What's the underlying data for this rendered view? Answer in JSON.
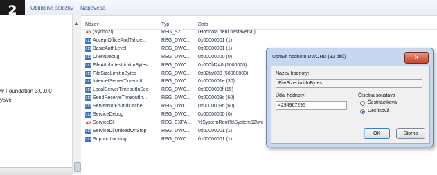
{
  "step_number": "2",
  "menu": {
    "favorites": "Oblíbené položky",
    "help": "Nápověda"
  },
  "left_pane": {
    "item1": "w Foundation 3.0.0.0",
    "item2": "y5vc"
  },
  "table": {
    "headers": {
      "name": "Název",
      "type": "Typ",
      "data": "Data"
    },
    "rows": [
      {
        "icon": "string-value-icon",
        "name": "(Výchozí)",
        "type": "REG_SZ",
        "data": "(Hodnota není nastavena.)"
      },
      {
        "icon": "binary-value-icon",
        "name": "AcceptOfficeAndTahoe...",
        "type": "REG_DWO...",
        "data": "0x00000001 (1)"
      },
      {
        "icon": "binary-value-icon",
        "name": "BasicAuthLevel",
        "type": "REG_DWO...",
        "data": "0x00000001 (1)"
      },
      {
        "icon": "binary-value-icon",
        "name": "ClientDebug",
        "type": "REG_DWO...",
        "data": "0x00000000 (0)"
      },
      {
        "icon": "binary-value-icon",
        "name": "FileAttributesLimitInBytes",
        "type": "REG_DWO...",
        "data": "0x000f4240 (1000000)"
      },
      {
        "icon": "binary-value-icon",
        "name": "FileSizeLimitInBytes",
        "type": "REG_DWO...",
        "data": "0x02faf080 (50000000)"
      },
      {
        "icon": "binary-value-icon",
        "name": "InternetServerTimeoutI...",
        "type": "REG_DWO...",
        "data": "0x0000001e (30)"
      },
      {
        "icon": "binary-value-icon",
        "name": "LocalServerTimeoutInSec",
        "type": "REG_DWO...",
        "data": "0x0000000f (15)"
      },
      {
        "icon": "binary-value-icon",
        "name": "SendReceiveTimeoutIn...",
        "type": "REG_DWO...",
        "data": "0x0000003c (60)"
      },
      {
        "icon": "binary-value-icon",
        "name": "ServerNotFoundCacheL...",
        "type": "REG_DWO...",
        "data": "0x0000003c (60)"
      },
      {
        "icon": "binary-value-icon",
        "name": "ServiceDebug",
        "type": "REG_DWO...",
        "data": "0x00000000 (0)"
      },
      {
        "icon": "string-value-icon",
        "name": "ServiceDll",
        "type": "REG_EXPA...",
        "data": "%SystemRoot%\\System32\\we"
      },
      {
        "icon": "binary-value-icon",
        "name": "ServiceDllUnloadOnStop",
        "type": "REG_DWO...",
        "data": "0x00000001 (1)"
      },
      {
        "icon": "binary-value-icon",
        "name": "SupportLocking",
        "type": "REG_DWO...",
        "data": "0x00000001 (1)"
      }
    ]
  },
  "dialog": {
    "title": "Upravit hodnotu DWORD (32 bitů)",
    "name_label": "Název hodnoty:",
    "name_value": "FileSizeLimitInBytes",
    "data_label": "Údaj hodnoty:",
    "data_value": "4294967295",
    "base_label": "Číselná soustava",
    "base_hex": "Šestnáctková",
    "base_dec": "Desítková",
    "selected_base": "Desítková",
    "ok": "OK",
    "cancel": "Storno"
  },
  "colors": {
    "dialog_frame": "#c6d7ef",
    "close_button": "#c2452c",
    "menu_text": "#3a57a8"
  }
}
